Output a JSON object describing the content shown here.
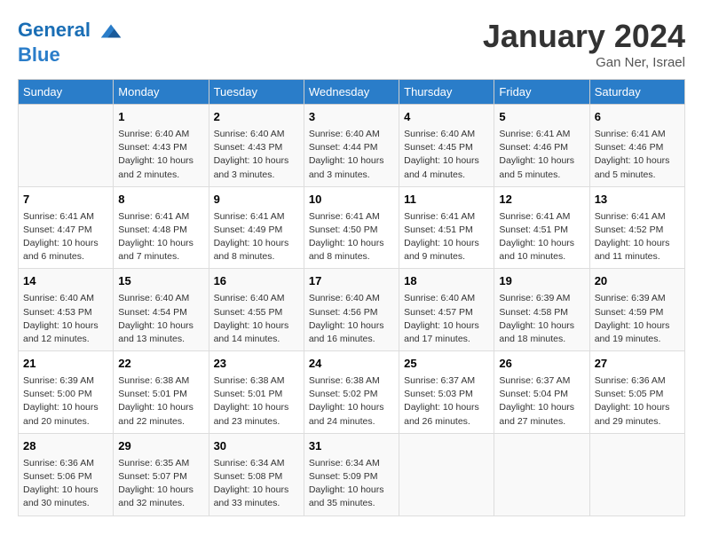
{
  "header": {
    "logo_line1": "General",
    "logo_line2": "Blue",
    "month_title": "January 2024",
    "location": "Gan Ner, Israel"
  },
  "weekdays": [
    "Sunday",
    "Monday",
    "Tuesday",
    "Wednesday",
    "Thursday",
    "Friday",
    "Saturday"
  ],
  "weeks": [
    [
      {
        "day": "",
        "info": ""
      },
      {
        "day": "1",
        "info": "Sunrise: 6:40 AM\nSunset: 4:43 PM\nDaylight: 10 hours\nand 2 minutes."
      },
      {
        "day": "2",
        "info": "Sunrise: 6:40 AM\nSunset: 4:43 PM\nDaylight: 10 hours\nand 3 minutes."
      },
      {
        "day": "3",
        "info": "Sunrise: 6:40 AM\nSunset: 4:44 PM\nDaylight: 10 hours\nand 3 minutes."
      },
      {
        "day": "4",
        "info": "Sunrise: 6:40 AM\nSunset: 4:45 PM\nDaylight: 10 hours\nand 4 minutes."
      },
      {
        "day": "5",
        "info": "Sunrise: 6:41 AM\nSunset: 4:46 PM\nDaylight: 10 hours\nand 5 minutes."
      },
      {
        "day": "6",
        "info": "Sunrise: 6:41 AM\nSunset: 4:46 PM\nDaylight: 10 hours\nand 5 minutes."
      }
    ],
    [
      {
        "day": "7",
        "info": "Sunrise: 6:41 AM\nSunset: 4:47 PM\nDaylight: 10 hours\nand 6 minutes."
      },
      {
        "day": "8",
        "info": "Sunrise: 6:41 AM\nSunset: 4:48 PM\nDaylight: 10 hours\nand 7 minutes."
      },
      {
        "day": "9",
        "info": "Sunrise: 6:41 AM\nSunset: 4:49 PM\nDaylight: 10 hours\nand 8 minutes."
      },
      {
        "day": "10",
        "info": "Sunrise: 6:41 AM\nSunset: 4:50 PM\nDaylight: 10 hours\nand 8 minutes."
      },
      {
        "day": "11",
        "info": "Sunrise: 6:41 AM\nSunset: 4:51 PM\nDaylight: 10 hours\nand 9 minutes."
      },
      {
        "day": "12",
        "info": "Sunrise: 6:41 AM\nSunset: 4:51 PM\nDaylight: 10 hours\nand 10 minutes."
      },
      {
        "day": "13",
        "info": "Sunrise: 6:41 AM\nSunset: 4:52 PM\nDaylight: 10 hours\nand 11 minutes."
      }
    ],
    [
      {
        "day": "14",
        "info": "Sunrise: 6:40 AM\nSunset: 4:53 PM\nDaylight: 10 hours\nand 12 minutes."
      },
      {
        "day": "15",
        "info": "Sunrise: 6:40 AM\nSunset: 4:54 PM\nDaylight: 10 hours\nand 13 minutes."
      },
      {
        "day": "16",
        "info": "Sunrise: 6:40 AM\nSunset: 4:55 PM\nDaylight: 10 hours\nand 14 minutes."
      },
      {
        "day": "17",
        "info": "Sunrise: 6:40 AM\nSunset: 4:56 PM\nDaylight: 10 hours\nand 16 minutes."
      },
      {
        "day": "18",
        "info": "Sunrise: 6:40 AM\nSunset: 4:57 PM\nDaylight: 10 hours\nand 17 minutes."
      },
      {
        "day": "19",
        "info": "Sunrise: 6:39 AM\nSunset: 4:58 PM\nDaylight: 10 hours\nand 18 minutes."
      },
      {
        "day": "20",
        "info": "Sunrise: 6:39 AM\nSunset: 4:59 PM\nDaylight: 10 hours\nand 19 minutes."
      }
    ],
    [
      {
        "day": "21",
        "info": "Sunrise: 6:39 AM\nSunset: 5:00 PM\nDaylight: 10 hours\nand 20 minutes."
      },
      {
        "day": "22",
        "info": "Sunrise: 6:38 AM\nSunset: 5:01 PM\nDaylight: 10 hours\nand 22 minutes."
      },
      {
        "day": "23",
        "info": "Sunrise: 6:38 AM\nSunset: 5:01 PM\nDaylight: 10 hours\nand 23 minutes."
      },
      {
        "day": "24",
        "info": "Sunrise: 6:38 AM\nSunset: 5:02 PM\nDaylight: 10 hours\nand 24 minutes."
      },
      {
        "day": "25",
        "info": "Sunrise: 6:37 AM\nSunset: 5:03 PM\nDaylight: 10 hours\nand 26 minutes."
      },
      {
        "day": "26",
        "info": "Sunrise: 6:37 AM\nSunset: 5:04 PM\nDaylight: 10 hours\nand 27 minutes."
      },
      {
        "day": "27",
        "info": "Sunrise: 6:36 AM\nSunset: 5:05 PM\nDaylight: 10 hours\nand 29 minutes."
      }
    ],
    [
      {
        "day": "28",
        "info": "Sunrise: 6:36 AM\nSunset: 5:06 PM\nDaylight: 10 hours\nand 30 minutes."
      },
      {
        "day": "29",
        "info": "Sunrise: 6:35 AM\nSunset: 5:07 PM\nDaylight: 10 hours\nand 32 minutes."
      },
      {
        "day": "30",
        "info": "Sunrise: 6:34 AM\nSunset: 5:08 PM\nDaylight: 10 hours\nand 33 minutes."
      },
      {
        "day": "31",
        "info": "Sunrise: 6:34 AM\nSunset: 5:09 PM\nDaylight: 10 hours\nand 35 minutes."
      },
      {
        "day": "",
        "info": ""
      },
      {
        "day": "",
        "info": ""
      },
      {
        "day": "",
        "info": ""
      }
    ]
  ]
}
